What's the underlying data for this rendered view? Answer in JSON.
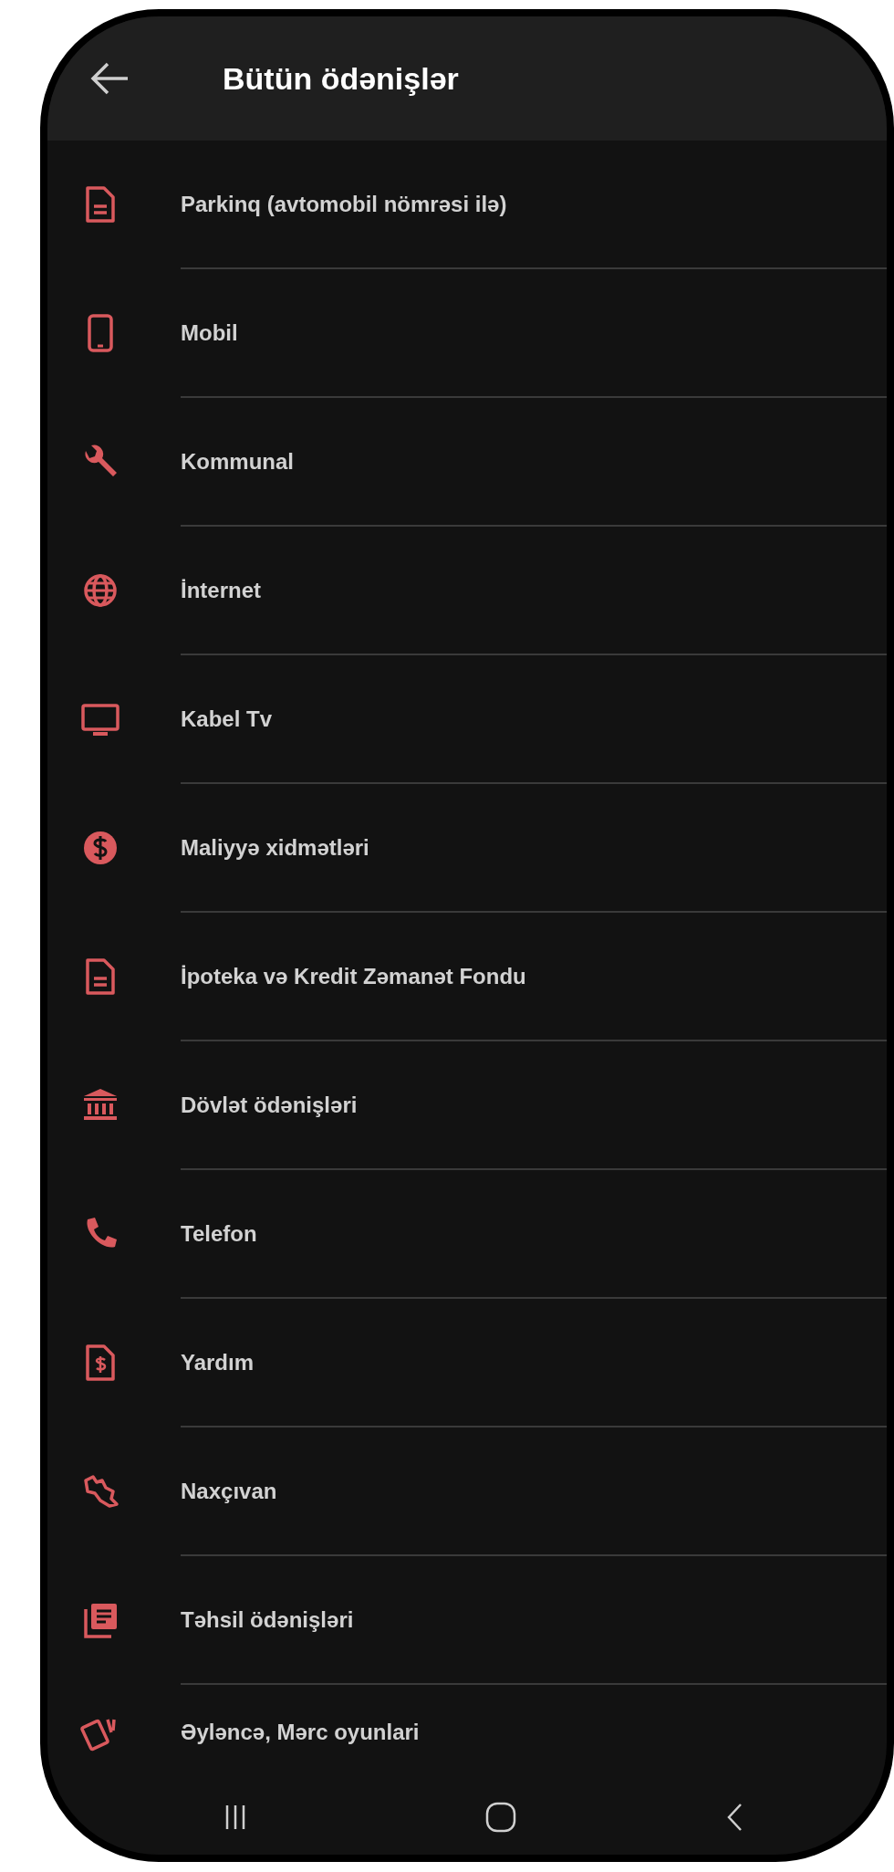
{
  "header": {
    "title": "Bütün ödənişlər"
  },
  "items": [
    {
      "label": "Parkinq (avtomobil nömrəsi ilə)"
    },
    {
      "label": "Mobil"
    },
    {
      "label": "Kommunal"
    },
    {
      "label": "İnternet"
    },
    {
      "label": "Kabel Tv"
    },
    {
      "label": "Maliyyə xidmətləri"
    },
    {
      "label": "İpoteka və Kredit Zəmanət Fondu"
    },
    {
      "label": "Dövlət ödənişləri"
    },
    {
      "label": "Telefon"
    },
    {
      "label": "Yardım"
    },
    {
      "label": "Naxçıvan"
    },
    {
      "label": "Təhsil ödənişləri"
    },
    {
      "label": "Əyləncə, Mərc oyunlari"
    }
  ]
}
